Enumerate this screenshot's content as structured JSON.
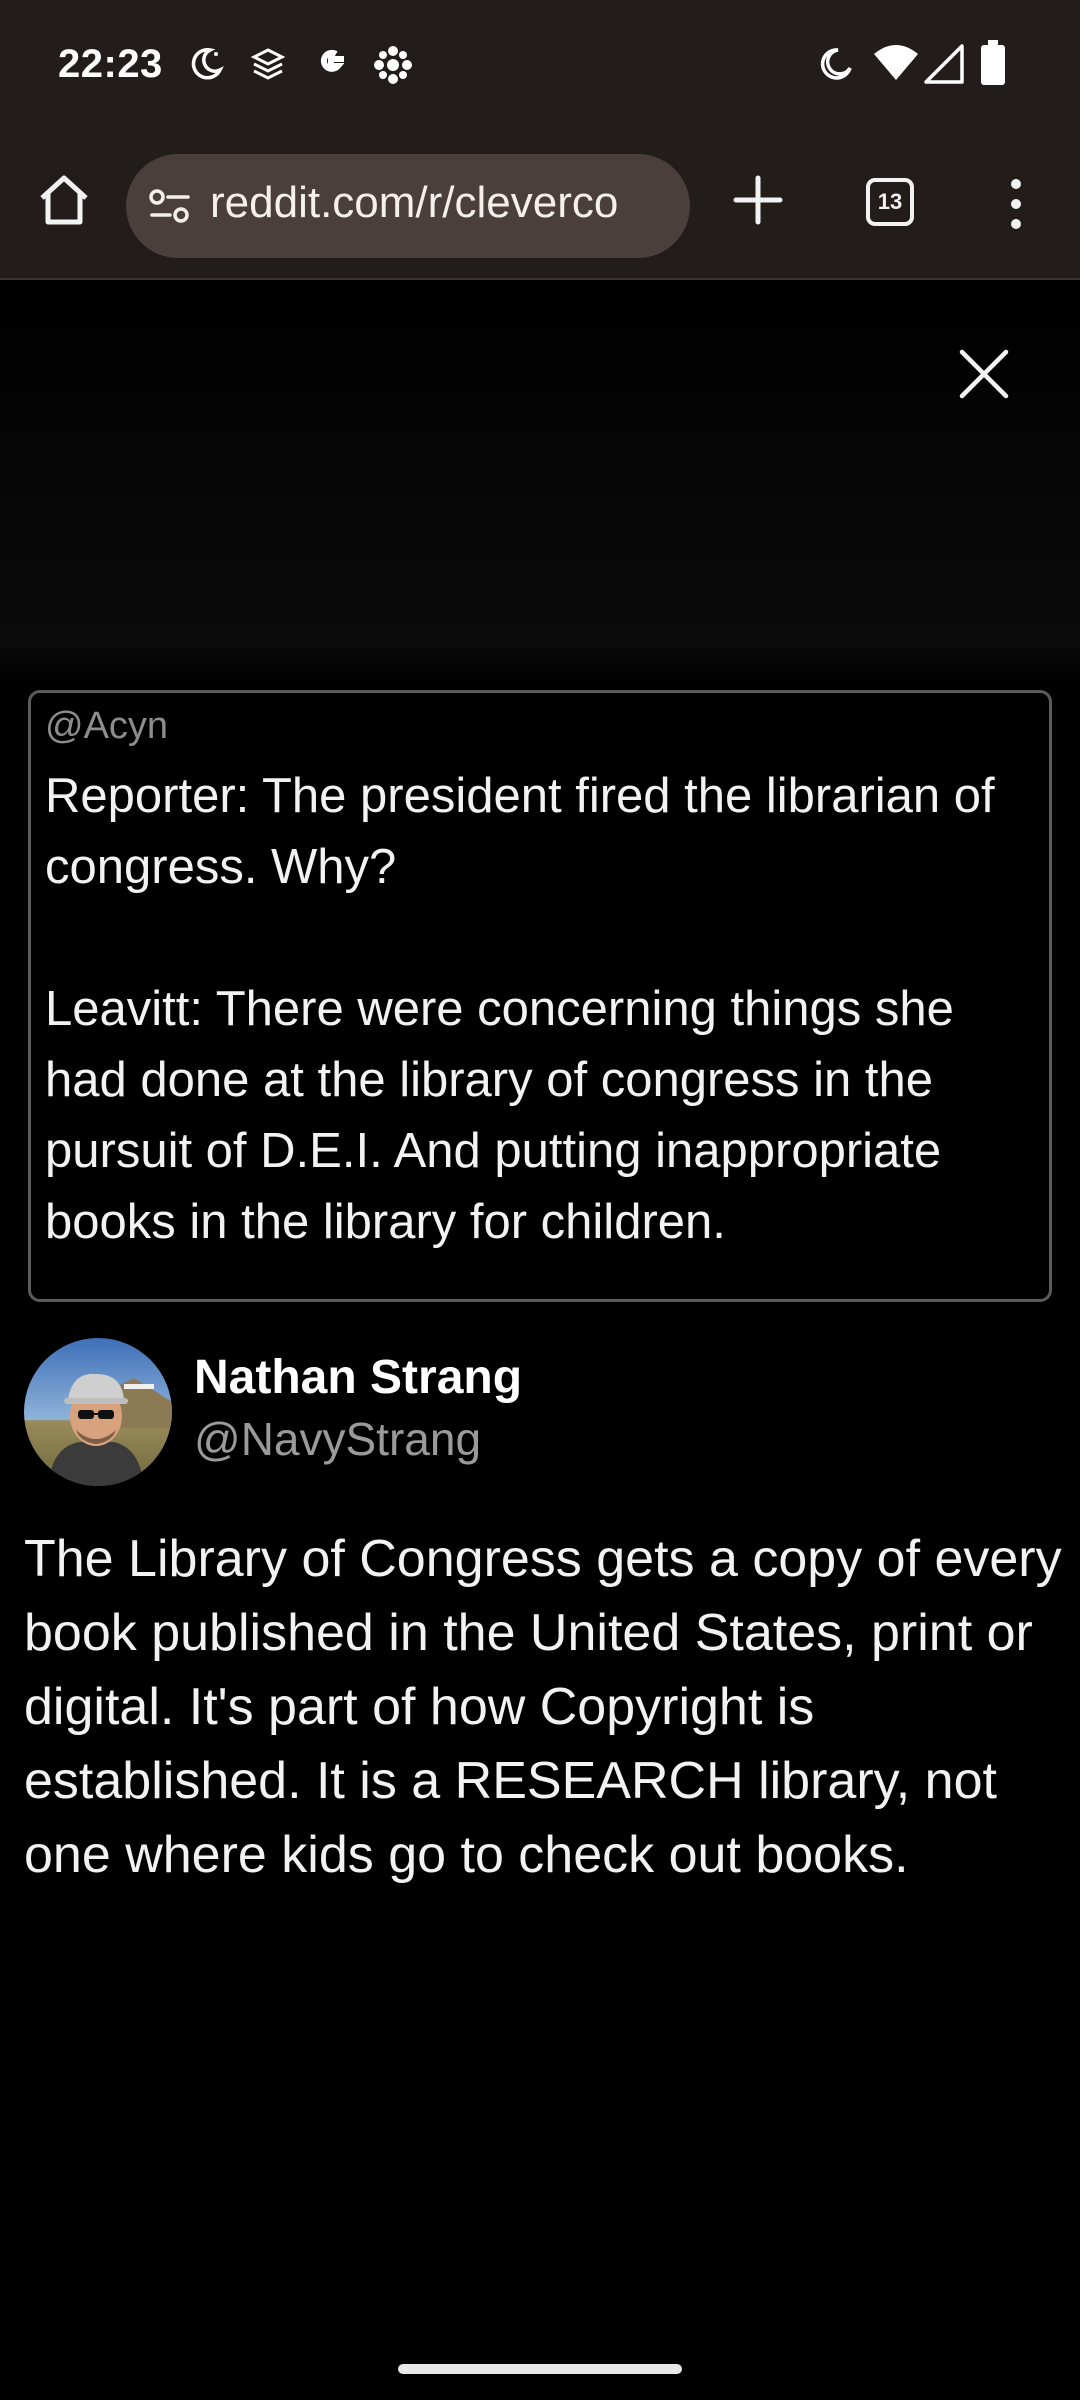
{
  "status_bar": {
    "time": "22:23",
    "left_icons": [
      "night-mode-icon",
      "app-icon",
      "google-icon",
      "cbc-icon"
    ],
    "right_icons": [
      "do-not-disturb-icon",
      "wifi-icon",
      "signal-icon",
      "battery-icon"
    ]
  },
  "browser": {
    "url": "reddit.com/r/cleverco",
    "tab_count": "13"
  },
  "quote": {
    "handle": "@Acyn",
    "text": "Reporter: The president fired the librarian of congress. Why?\n\nLeavitt: There were concerning things she had done at the library of congress in the pursuit of D.E.I. And putting inappropriate books in the library for children."
  },
  "post": {
    "author_name": "Nathan Strang",
    "author_handle": "@NavyStrang",
    "text": "The Library of Congress gets a copy of every book published in the United States, print or digital. It's part of how Copyright is established. It is a RESEARCH library, not one where kids go to check out books."
  },
  "colors": {
    "chrome_bg": "#221c1b",
    "url_pill_bg": "#4a3f3b",
    "page_bg": "#000000",
    "muted_text": "#9a9a9a"
  }
}
